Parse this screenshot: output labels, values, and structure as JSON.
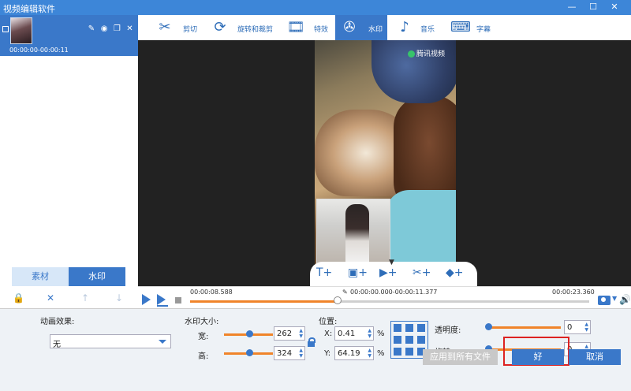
{
  "window": {
    "title": "视频编辑软件",
    "min_glyph": "—",
    "max_glyph": "☐",
    "close_glyph": "✕"
  },
  "clip": {
    "time_range": "00:00:00-00:00:11",
    "edit_glyph": "✎",
    "view_glyph": "◉",
    "copy_glyph": "❐",
    "close_glyph": "✕"
  },
  "side_tabs": {
    "material": "素材",
    "watermark": "水印"
  },
  "side_tools": {
    "lock_glyph": "🔒",
    "delete_glyph": "✕",
    "up_glyph": "↑",
    "down_glyph": "↓"
  },
  "toolbar": {
    "cut": "剪切",
    "rotate_crop": "旋转和裁剪",
    "effects": "特效",
    "watermark": "水印",
    "music": "音乐",
    "subtitle": "字幕",
    "active": "watermark"
  },
  "video": {
    "logo_text": "腾讯视频"
  },
  "watermark_tray": {
    "add_text_glyph": "T+",
    "add_image_glyph": "▣+",
    "add_video_glyph": "▶+",
    "add_effect_glyph": "✂+",
    "add_mosaic_glyph": "◆+",
    "expand_glyph": "▼"
  },
  "timeline": {
    "current": "00:00:08.588",
    "range": "00:00:00.000-00:00:11.377",
    "total": "00:00:23.360",
    "progress": 0.37
  },
  "panel": {
    "animation_label": "动画效果:",
    "animation_value": "无",
    "size_label": "水印大小:",
    "width_label": "宽:",
    "width_value": "262",
    "height_label": "高:",
    "height_value": "324",
    "width_slider": 0.52,
    "height_slider": 0.52,
    "position_label": "位置:",
    "x_label": "X:",
    "x_value": "0.41",
    "y_label": "Y:",
    "y_value": "64.19",
    "percent": "%",
    "opacity_label": "透明度:",
    "opacity_value": "0",
    "rotate_label": "旋转:",
    "rotate_value": "0",
    "apply_all": "应用到所有文件",
    "ok": "好",
    "cancel": "取消"
  },
  "colors": {
    "accent": "#3a78c9",
    "slider": "#f0842a",
    "highlight": "#dd2222"
  }
}
